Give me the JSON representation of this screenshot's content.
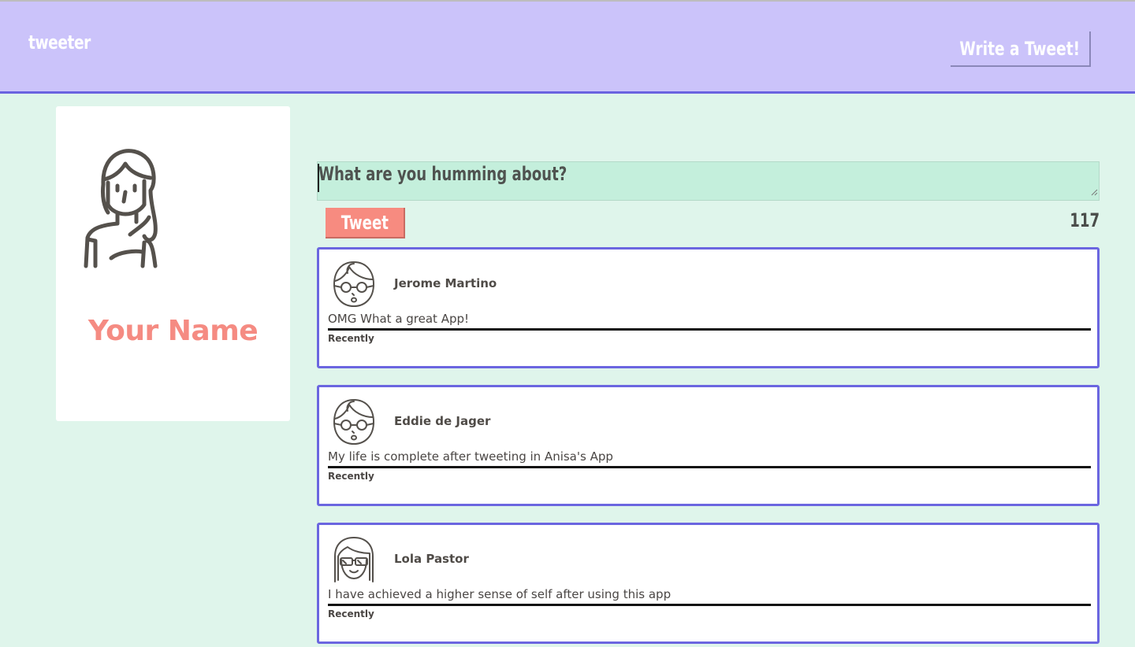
{
  "header": {
    "brand": "tweeter",
    "write_button_label": "Write a Tweet!",
    "background_color": "#cbc3fa",
    "accent_color": "#6a63e0"
  },
  "profile": {
    "avatar_icon": "woman-avatar-icon",
    "name": "Your Name",
    "name_color": "#f58b82"
  },
  "composer": {
    "placeholder": "What are you humming about?",
    "tweet_button_label": "Tweet",
    "char_counter": "117",
    "tweet_button_color": "#f78b80"
  },
  "tweets": [
    {
      "avatar_icon": "man-glasses-avatar-icon",
      "name": "Jerome Martino",
      "text": "OMG What a great App!",
      "time": "Recently"
    },
    {
      "avatar_icon": "man-glasses-avatar-icon",
      "name": "Eddie de Jager",
      "text": "My life is complete after tweeting in Anisa's App",
      "time": "Recently"
    },
    {
      "avatar_icon": "woman-sunglasses-avatar-icon",
      "name": "Lola Pastor",
      "text": "I have achieved a higher sense of self after using this app",
      "time": "Recently"
    }
  ]
}
